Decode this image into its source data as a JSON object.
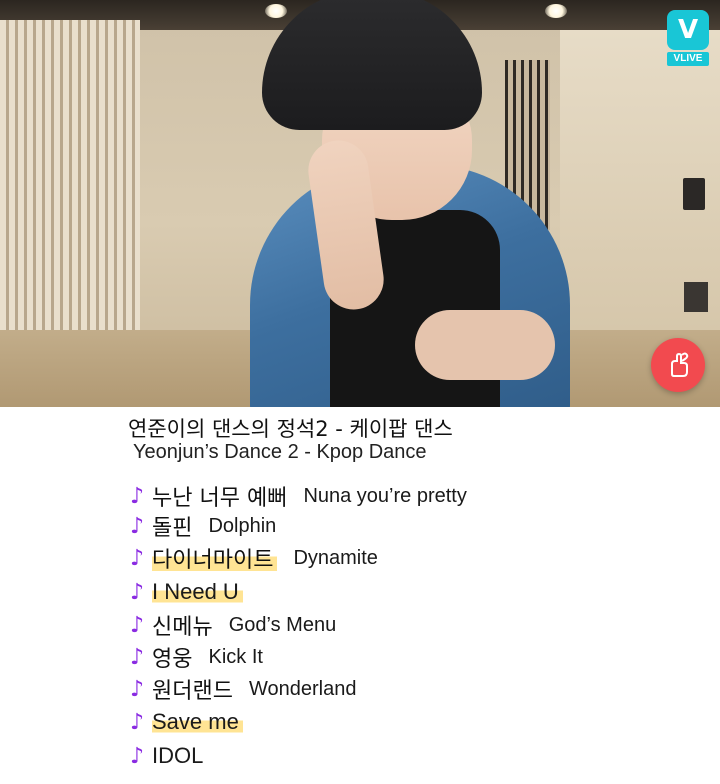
{
  "video": {
    "brand_logo_text": "VLIVE",
    "brand_logo_glyph": "V",
    "heart_icon": "finger-heart-icon",
    "accent_color": "#19c6d6",
    "heart_color": "#f24a4f"
  },
  "titles": {
    "korean": "연준이의 댄스의 정석2 - 케이팝 댄스",
    "english": "Yeonjun’s Dance 2 - Kpop Dance"
  },
  "note_glyph": "♪",
  "note_color": "#8a2be2",
  "songs": [
    {
      "korean": "누난 너무 예뻐",
      "english": "Nuna you’re pretty",
      "highlighted": false
    },
    {
      "korean": "돌핀",
      "english": "Dolphin",
      "highlighted": false
    },
    {
      "korean": "다이너마이트",
      "english": "Dynamite",
      "highlighted": true
    },
    {
      "korean": "",
      "english": "I Need U",
      "highlighted": true
    },
    {
      "korean": "신메뉴",
      "english": "God’s Menu",
      "highlighted": false
    },
    {
      "korean": "영웅",
      "english": "Kick It",
      "highlighted": false
    },
    {
      "korean": "원더랜드",
      "english": "Wonderland",
      "highlighted": false
    },
    {
      "korean": "",
      "english": "Save me",
      "highlighted": true
    },
    {
      "korean": "",
      "english": "IDOL",
      "highlighted": false
    }
  ]
}
